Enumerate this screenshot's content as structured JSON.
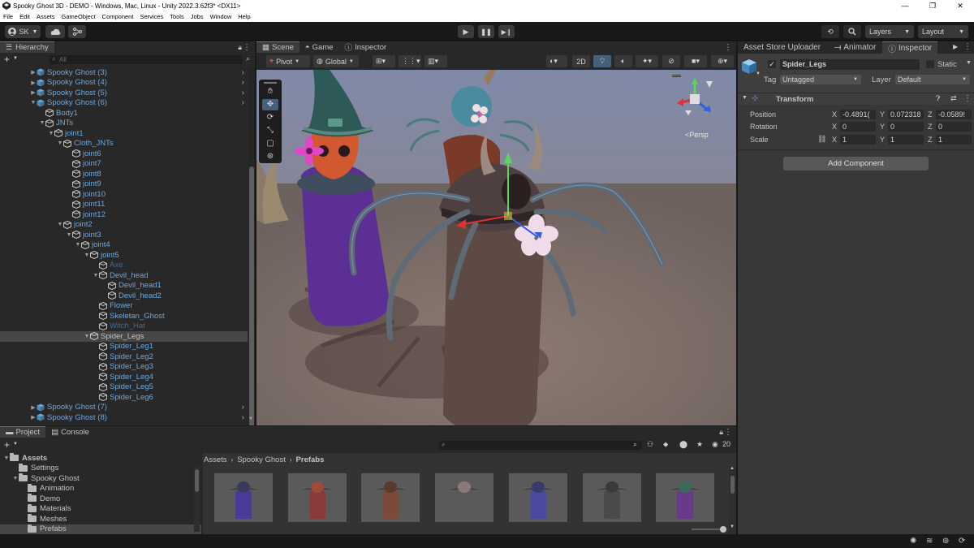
{
  "window": {
    "title": "Spooky Ghost 3D - DEMO - Windows, Mac, Linux - Unity 2022.3.62f3* <DX11>",
    "controls": [
      "—",
      "❐",
      "✕"
    ]
  },
  "menu": [
    "File",
    "Edit",
    "Assets",
    "GameObject",
    "Component",
    "Services",
    "Tools",
    "Jobs",
    "Window",
    "Help"
  ],
  "toolbar": {
    "account": "SK",
    "layers": "Layers",
    "layout": "Layout"
  },
  "hierarchy": {
    "tab": "Hierarchy",
    "search_placeholder": "All",
    "rows": [
      {
        "label": "Spooky Ghost (3)",
        "depth": 0,
        "arrow": "▶",
        "style": "prefab",
        "chev": true
      },
      {
        "label": "Spooky Ghost (4)",
        "depth": 0,
        "arrow": "▶",
        "style": "prefab",
        "chev": true
      },
      {
        "label": "Spooky Ghost (5)",
        "depth": 0,
        "arrow": "▶",
        "style": "prefab",
        "chev": true
      },
      {
        "label": "Spooky Ghost (6)",
        "depth": 0,
        "arrow": "▼",
        "style": "prefab",
        "chev": true
      },
      {
        "label": "Body1",
        "depth": 1,
        "arrow": "",
        "style": "prefab"
      },
      {
        "label": "JNTs",
        "depth": 1,
        "arrow": "▼",
        "style": "prefab"
      },
      {
        "label": "joint1",
        "depth": 2,
        "arrow": "▼",
        "style": "prefab"
      },
      {
        "label": "Cloth_JNTs",
        "depth": 3,
        "arrow": "▼",
        "style": "prefab"
      },
      {
        "label": "joint6",
        "depth": 4,
        "arrow": "",
        "style": "prefab"
      },
      {
        "label": "joint7",
        "depth": 4,
        "arrow": "",
        "style": "prefab"
      },
      {
        "label": "joint8",
        "depth": 4,
        "arrow": "",
        "style": "prefab"
      },
      {
        "label": "joint9",
        "depth": 4,
        "arrow": "",
        "style": "prefab"
      },
      {
        "label": "joint10",
        "depth": 4,
        "arrow": "",
        "style": "prefab"
      },
      {
        "label": "joint11",
        "depth": 4,
        "arrow": "",
        "style": "prefab"
      },
      {
        "label": "joint12",
        "depth": 4,
        "arrow": "",
        "style": "prefab"
      },
      {
        "label": "joint2",
        "depth": 3,
        "arrow": "▼",
        "style": "prefab"
      },
      {
        "label": "joint3",
        "depth": 4,
        "arrow": "▼",
        "style": "prefab"
      },
      {
        "label": "joint4",
        "depth": 5,
        "arrow": "▼",
        "style": "prefab"
      },
      {
        "label": "joint5",
        "depth": 6,
        "arrow": "▼",
        "style": "prefab"
      },
      {
        "label": "Axe",
        "depth": 7,
        "arrow": "",
        "style": "faded"
      },
      {
        "label": "Devil_head",
        "depth": 7,
        "arrow": "▼",
        "style": "prefab"
      },
      {
        "label": "Devil_head1",
        "depth": 8,
        "arrow": "",
        "style": "prefab"
      },
      {
        "label": "Devil_head2",
        "depth": 8,
        "arrow": "",
        "style": "prefab"
      },
      {
        "label": "Flower",
        "depth": 7,
        "arrow": "",
        "style": "prefab"
      },
      {
        "label": "Skeletan_Ghost",
        "depth": 7,
        "arrow": "",
        "style": "prefab"
      },
      {
        "label": "Witch_Hat",
        "depth": 7,
        "arrow": "",
        "style": "faded"
      },
      {
        "label": "Spider_Legs",
        "depth": 6,
        "arrow": "▼",
        "style": "selected"
      },
      {
        "label": "Spider_Leg1",
        "depth": 7,
        "arrow": "",
        "style": "prefab"
      },
      {
        "label": "Spider_Leg2",
        "depth": 7,
        "arrow": "",
        "style": "prefab"
      },
      {
        "label": "Spider_Leg3",
        "depth": 7,
        "arrow": "",
        "style": "prefab"
      },
      {
        "label": "Spider_Leg4",
        "depth": 7,
        "arrow": "",
        "style": "prefab"
      },
      {
        "label": "Spider_Leg5",
        "depth": 7,
        "arrow": "",
        "style": "prefab"
      },
      {
        "label": "Spider_Leg6",
        "depth": 7,
        "arrow": "",
        "style": "prefab"
      },
      {
        "label": "Spooky Ghost (7)",
        "depth": 0,
        "arrow": "▶",
        "style": "prefab",
        "chev": true
      },
      {
        "label": "Spooky Ghost (8)",
        "depth": 0,
        "arrow": "▶",
        "style": "prefab",
        "chev": true
      }
    ]
  },
  "scene": {
    "tabs": [
      "Scene",
      "Game",
      "Inspector"
    ],
    "pivot": "Pivot",
    "global": "Global",
    "mode_2d": "2D",
    "persp": "<Persp"
  },
  "inspector": {
    "tabs": [
      "Asset Store Uploader",
      "Animator",
      "Inspector"
    ],
    "object_name": "Spider_Legs",
    "static_label": "Static",
    "tag_label": "Tag",
    "tag_value": "Untagged",
    "layer_label": "Layer",
    "layer_value": "Default",
    "component": "Transform",
    "position_label": "Position",
    "rotation_label": "Rotation",
    "scale_label": "Scale",
    "position": {
      "x": "-0.4891(",
      "y": "0.072318",
      "z": "-0.0589!"
    },
    "rotation": {
      "x": "0",
      "y": "0",
      "z": "0"
    },
    "scale": {
      "x": "1",
      "y": "1",
      "z": "1"
    },
    "add_component": "Add Component"
  },
  "project": {
    "tabs": [
      "Project",
      "Console"
    ],
    "tree": [
      {
        "label": "Assets",
        "depth": 0,
        "arrow": "▼",
        "bold": true
      },
      {
        "label": "Settings",
        "depth": 1,
        "arrow": ""
      },
      {
        "label": "Spooky Ghost",
        "depth": 1,
        "arrow": "▼"
      },
      {
        "label": "Animation",
        "depth": 2,
        "arrow": ""
      },
      {
        "label": "Demo",
        "depth": 2,
        "arrow": ""
      },
      {
        "label": "Materials",
        "depth": 2,
        "arrow": ""
      },
      {
        "label": "Meshes",
        "depth": 2,
        "arrow": ""
      },
      {
        "label": "Prefabs",
        "depth": 2,
        "arrow": "",
        "selected": true
      }
    ],
    "breadcrumb": [
      "Assets",
      "Spooky Ghost",
      "Prefabs"
    ],
    "hidden_count": "20",
    "thumbnails": [
      {
        "cloak": "#4a3a9a",
        "head": "#3a3a5a"
      },
      {
        "cloak": "#8a3a3a",
        "head": "#a04a3a"
      },
      {
        "cloak": "#7a4a3a",
        "head": "#5a3a2a"
      },
      {
        "cloak": "#5a5a5a",
        "head": "#8a7a7a"
      },
      {
        "cloak": "#4a4aa0",
        "head": "#3a3a6a"
      },
      {
        "cloak": "#4a4a4a",
        "head": "#3a3a3a"
      },
      {
        "cloak": "#6a3a8a",
        "head": "#3a6a5a"
      }
    ]
  }
}
